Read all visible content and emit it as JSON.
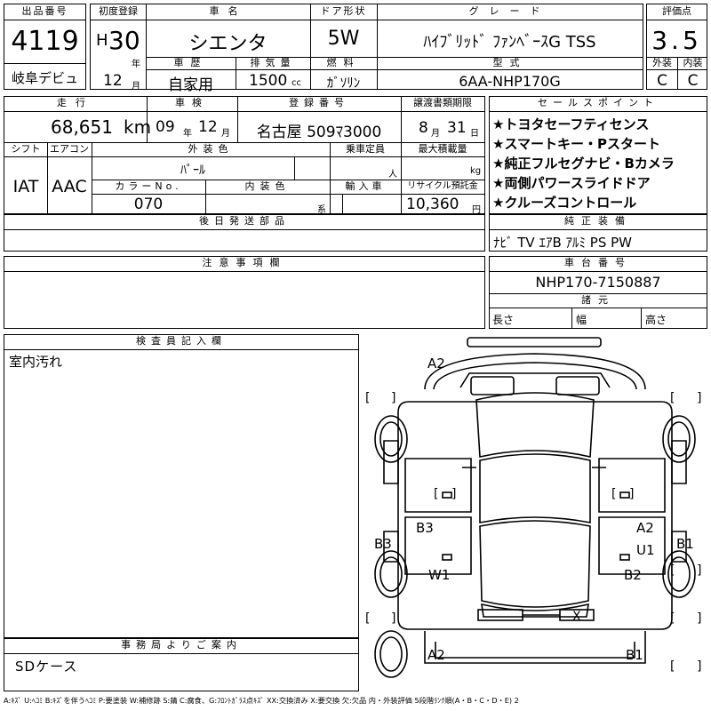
{
  "header": {
    "lot_label": "出品番号",
    "lot_no": "4119",
    "lot_sub": "岐阜デビュ",
    "first_reg_label": "初度登録",
    "era": "H",
    "year": "30",
    "year_unit": "年",
    "month": "12",
    "month_unit": "月",
    "car_name_label": "車名",
    "car_name": "シエンタ",
    "door_label": "ドア形状",
    "door": "5W",
    "grade_label": "グレード",
    "grade": "ﾊｲﾌﾞﾘｯﾄﾞ ﾌｧﾝﾍﾞｰｽG TSS",
    "score_label": "評価点",
    "score": "3.5",
    "history_label": "車歴",
    "history": "自家用",
    "displacement_label": "排気量",
    "displacement": "1500",
    "displacement_unit": "cc",
    "fuel_label": "燃料",
    "fuel": "ｶﾞｿﾘﾝ",
    "model_label": "型式",
    "model": "6AA-NHP170G",
    "ext_label": "外装",
    "int_label": "内装",
    "ext_grade": "C",
    "int_grade": "C"
  },
  "row2": {
    "mileage_label": "走行",
    "mileage": "68,651",
    "mileage_unit": "km",
    "inspection_label": "車検",
    "insp_year": "09",
    "insp_year_unit": "年",
    "insp_month": "12",
    "insp_month_unit": "月",
    "reg_no_label": "登録番号",
    "reg_no": "名古屋 509ﾏ3000",
    "transfer_label": "譲渡書類期限",
    "transfer_month": "8",
    "transfer_month_unit": "月",
    "transfer_day": "31",
    "transfer_day_unit": "日",
    "shift_label": "シフト",
    "shift": "IAT",
    "ac_label": "エアコン",
    "ac": "AAC",
    "color_label": "外装色",
    "color": "ﾊﾟｰﾙ",
    "capacity_label": "乗車定員",
    "capacity_unit": "人",
    "load_label": "最大積載量",
    "load_unit": "kg",
    "color_no_label": "カラーNo.",
    "color_no": "070",
    "int_color_label": "内装色",
    "int_color_unit": "系",
    "import_label": "輸入車",
    "recycle_label": "リサイクル預託金",
    "recycle": "10,360",
    "recycle_unit": "円"
  },
  "sales_points": {
    "label": "セールスポイント",
    "items": [
      "★トヨタセーフティセンス",
      "★スマートキー・Pスタート",
      "★純正フルセグナビ・Bカメラ",
      "★両側パワースライドドア",
      "★クルーズコントロール"
    ]
  },
  "later_parts": {
    "label": "後日発送部品"
  },
  "genuine": {
    "label": "純正装備",
    "value": "ﾅﾋﾞ TV ｴｱB ｱﾙﾐ PS PW"
  },
  "notes": {
    "label": "注意事項欄"
  },
  "chassis": {
    "label": "車台番号",
    "value": "NHP170-7150887"
  },
  "specs": {
    "label": "諸元",
    "length": "長さ",
    "width": "幅",
    "height": "高さ"
  },
  "inspector": {
    "label": "検査員記入欄",
    "text": "室内汚れ"
  },
  "office": {
    "label": "事務局よりご案内",
    "text": "SDケース"
  },
  "diagram": {
    "marks": [
      "A2",
      "B3",
      "B3",
      "W1",
      "A2",
      "U1",
      "B1",
      "B2",
      "X",
      "A2",
      "B1"
    ],
    "brackets": [
      "[",
      "]",
      "[",
      "]",
      "[",
      "]",
      "[",
      "]",
      "[",
      "]",
      "[",
      "]",
      "[",
      "]",
      "[",
      "]"
    ]
  },
  "legend": "A:ｷｽﾞ U:ﾍｺﾐ B:ｷｽﾞを伴うﾍｺﾐ P:要塗装 W:補修跡 S:錆 C:腐食、G:ﾌﾛﾝﾄｶﾞﾗｽ点ｷｽﾞ XX:交換済み X:要交換 欠:欠品 内・外装評価 5段階ﾗﾝｸ順(A・B・C・D・E) 2"
}
